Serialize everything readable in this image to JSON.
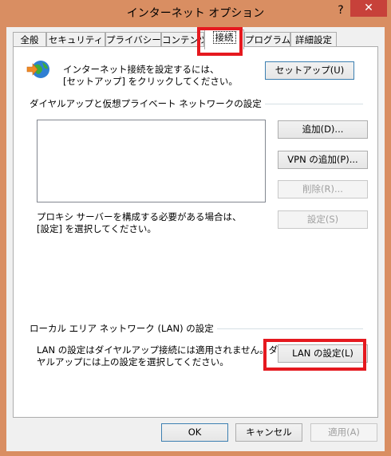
{
  "window": {
    "title": "インターネット オプション",
    "help_icon": "?",
    "close_icon": "✕"
  },
  "tabs": [
    {
      "label": "全般"
    },
    {
      "label": "セキュリティ"
    },
    {
      "label": "プライバシー"
    },
    {
      "label": "コンテンツ"
    },
    {
      "label": "接続"
    },
    {
      "label": "プログラム"
    },
    {
      "label": "詳細設定"
    }
  ],
  "setup": {
    "line1": "インターネット接続を設定するには、",
    "line2": "[セットアップ] をクリックしてください。",
    "button": "セットアップ(U)",
    "icon": "globe-arrow-icon"
  },
  "dialup": {
    "group_label": "ダイヤルアップと仮想プライベート ネットワークの設定",
    "add_button": "追加(D)...",
    "add_vpn_button": "VPN の追加(P)...",
    "remove_button": "削除(R)...",
    "settings_button": "設定(S)",
    "proxy_line1": "プロキシ サーバーを構成する必要がある場合は、",
    "proxy_line2": "[設定] を選択してください。"
  },
  "lan": {
    "group_label": "ローカル エリア ネットワーク (LAN) の設定",
    "line1": "LAN の設定はダイヤルアップ接続には適用されません。ダイ",
    "line2": "ヤルアップには上の設定を選択してください。",
    "button": "LAN の設定(L)"
  },
  "footer": {
    "ok": "OK",
    "cancel": "キャンセル",
    "apply": "適用(A)"
  },
  "colors": {
    "titlebar": "#d98e62",
    "close": "#c7413a",
    "highlight": "#e5191f"
  }
}
